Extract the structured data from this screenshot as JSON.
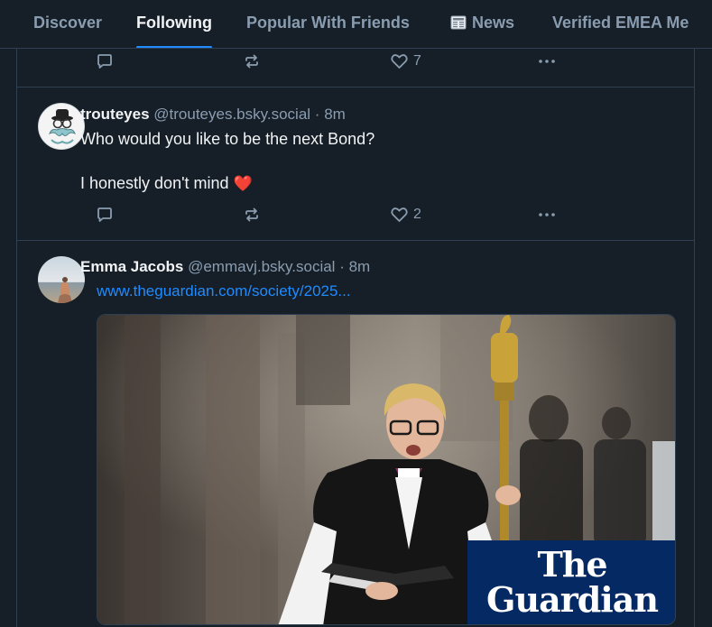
{
  "tabs": [
    {
      "label": "Discover"
    },
    {
      "label": "Following"
    },
    {
      "label": "Popular With Friends"
    },
    {
      "label": "News"
    },
    {
      "label": "Verified EMEA Me"
    }
  ],
  "active_tab": "Following",
  "posts": [
    {
      "likes": "7"
    },
    {
      "display_name": "trouteyes",
      "handle": "@trouteyes.bsky.social",
      "time": "8m",
      "line1": "Who would you like to be the next Bond?",
      "line2": "I honestly don't mind",
      "emoji": "❤️",
      "likes": "2"
    },
    {
      "display_name": "Emma Jacobs",
      "handle": "@emmavj.bsky.social",
      "time": "8m",
      "link": "www.theguardian.com/society/2025...",
      "embed_logo_line1": "The",
      "embed_logo_line2": "Guardian"
    }
  ],
  "colors": {
    "background": "#161e27",
    "border": "#2e4052",
    "muted": "#8a9db0",
    "link": "#208bfe",
    "guardian_blue": "#052962"
  },
  "icons": [
    "reply-icon",
    "repost-icon",
    "like-icon",
    "more-icon",
    "newspaper-icon"
  ]
}
